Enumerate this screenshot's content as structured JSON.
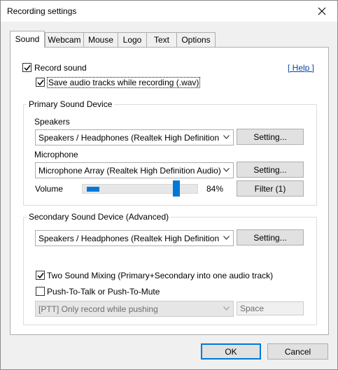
{
  "window": {
    "title": "Recording settings"
  },
  "tabs": [
    "Sound",
    "Webcam",
    "Mouse",
    "Logo",
    "Text",
    "Options"
  ],
  "active_tab": "Sound",
  "sound": {
    "record_sound_label": "Record sound",
    "record_sound_checked": true,
    "help_link": "[ Help ]",
    "save_wav_label": "Save audio tracks while recording (.wav)",
    "save_wav_checked": true,
    "primary": {
      "title": "Primary Sound Device",
      "speakers_label": "Speakers",
      "speakers_value": "Speakers / Headphones (Realtek High Definition Audio)",
      "speakers_setting_btn": "Setting...",
      "microphone_label": "Microphone",
      "microphone_value": "Microphone Array (Realtek High Definition Audio)",
      "microphone_setting_btn": "Setting...",
      "volume_label": "Volume",
      "volume_level": 0.84,
      "volume_percent": "84%",
      "filter_btn": "Filter (1)"
    },
    "secondary": {
      "title": "Secondary Sound Device (Advanced)",
      "device_value": "Speakers / Headphones (Realtek High Definition Audio)",
      "setting_btn": "Setting...",
      "two_mixing_label": "Two Sound Mixing (Primary+Secondary into one audio track)",
      "two_mixing_checked": true,
      "ptt_label": "Push-To-Talk or Push-To-Mute",
      "ptt_checked": false,
      "ptt_mode_value": "[PTT] Only record while pushing",
      "ptt_key_value": "Space"
    }
  },
  "footer": {
    "ok_btn": "OK",
    "cancel_btn": "Cancel"
  },
  "colors": {
    "accent": "#0078d7",
    "link": "#0645ad",
    "panel_bg": "#ffffff",
    "window_bg": "#f0f0f0"
  }
}
